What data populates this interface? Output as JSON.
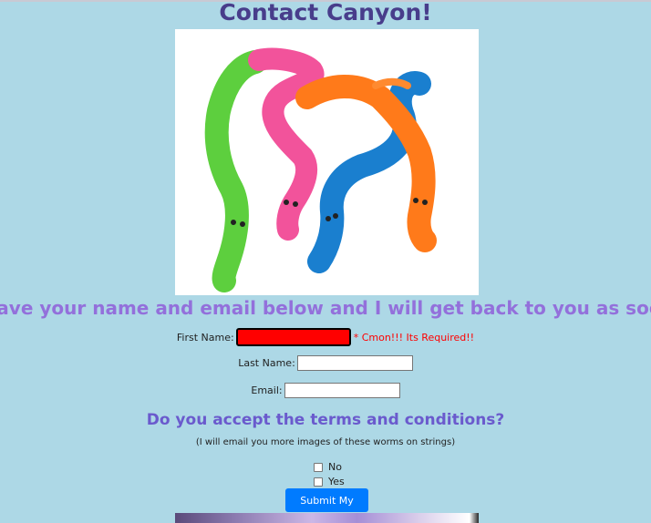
{
  "page": {
    "title": "Contact Canyon!",
    "hero_image": "colorful-fuzzy-worms-image",
    "tagline": "Leave your name and email below and I will get back to you as soon as possible"
  },
  "form": {
    "first_name_label": "First Name:",
    "first_name_value": "",
    "first_name_error": "* Cmon!!! Its Required!!",
    "last_name_label": "Last Name:",
    "last_name_value": "",
    "email_label": "Email:",
    "email_value": ""
  },
  "terms": {
    "heading": "Do you accept the terms and conditions?",
    "subtext": "(I will email you more images of these worms on strings)",
    "options": [
      "No",
      "Yes"
    ]
  },
  "submit_label": "Submit My Info",
  "colors": {
    "background": "#add8e6",
    "title": "#483d8b",
    "tagline": "#9370db",
    "terms_heading": "#6a5acd",
    "error_field": "#ff0000",
    "error_text": "#ff0000",
    "submit": "#007bff"
  }
}
